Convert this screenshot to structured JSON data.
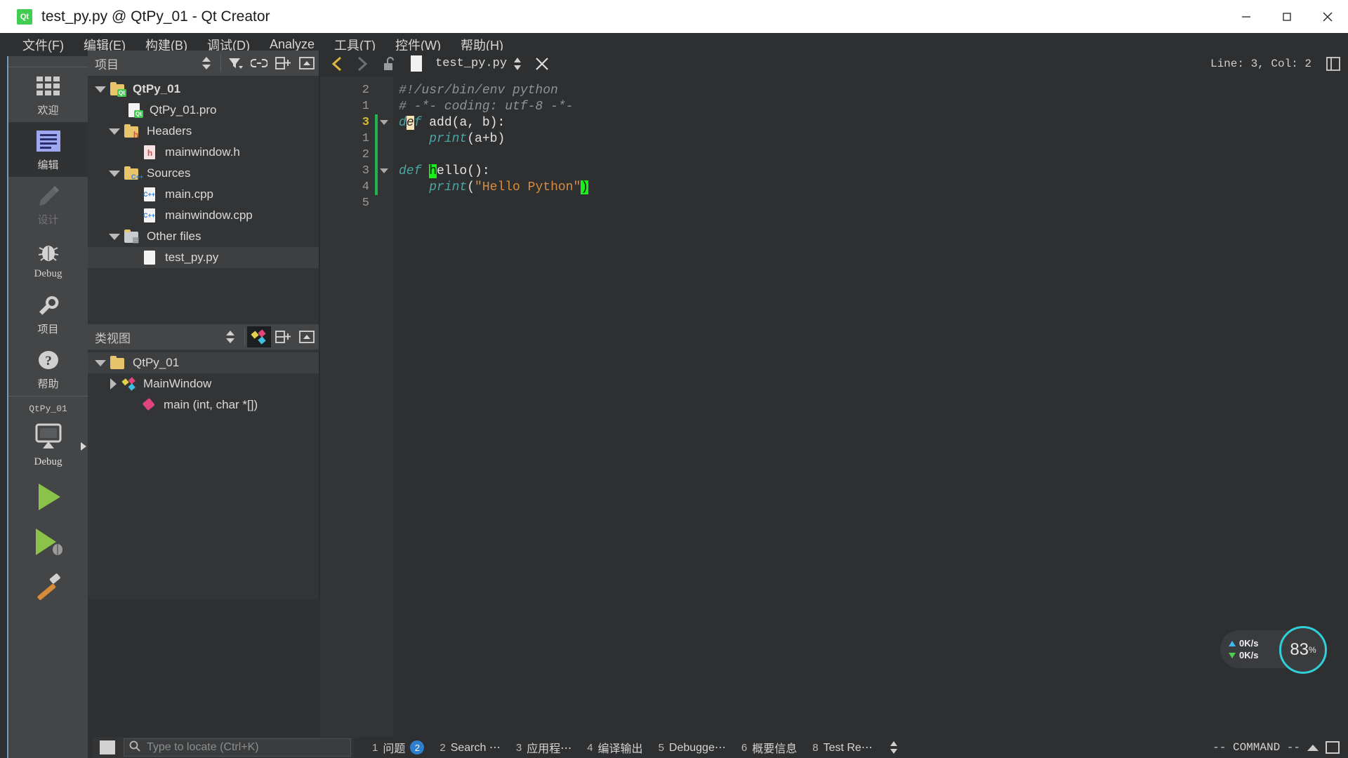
{
  "window": {
    "title": "test_py.py @ QtPy_01 - Qt Creator",
    "app_icon": "qt-logo-icon",
    "minimize": "—",
    "maximize": "□",
    "close": "✕"
  },
  "menubar": {
    "items": [
      {
        "label": "文件(F)"
      },
      {
        "label": "编辑(E)"
      },
      {
        "label": "构建(B)"
      },
      {
        "label": "调试(D)"
      },
      {
        "label": "Analyze"
      },
      {
        "label": "工具(T)"
      },
      {
        "label": "控件(W)"
      },
      {
        "label": "帮助(H)"
      }
    ]
  },
  "modebar": {
    "modes": [
      {
        "label": "欢迎",
        "icon": "grid-icon",
        "state": "normal"
      },
      {
        "label": "编辑",
        "icon": "lines-icon",
        "state": "selected"
      },
      {
        "label": "设计",
        "icon": "pencil-icon",
        "state": "disabled"
      },
      {
        "label": "Debug",
        "icon": "bug-icon",
        "state": "normal"
      },
      {
        "label": "项目",
        "icon": "wrench-icon",
        "state": "normal"
      },
      {
        "label": "帮助",
        "icon": "question-icon",
        "state": "normal"
      }
    ],
    "kit": {
      "project": "QtPy_01",
      "icon": "monitor-icon",
      "build_config": "Debug",
      "expand": "kit-expand-arrow"
    },
    "run_buttons": [
      {
        "name": "run-button",
        "icon": "green-play-icon"
      },
      {
        "name": "debug-button",
        "icon": "green-play-bug-icon"
      },
      {
        "name": "build-button",
        "icon": "hammer-icon"
      }
    ]
  },
  "projects_panel": {
    "title": "项目",
    "toolbar": [
      {
        "name": "sort-selector",
        "icon": "up-down-arrows-icon"
      },
      {
        "name": "filter-button",
        "icon": "filter-icon"
      },
      {
        "name": "sync-button",
        "icon": "link-icon"
      },
      {
        "name": "split-button",
        "icon": "split-add-icon"
      },
      {
        "name": "close-panel-button",
        "icon": "close-pane-icon"
      }
    ],
    "tree": [
      {
        "label": "QtPy_01",
        "indent": 0,
        "arrow": "down",
        "icon": "qt-folder-icon",
        "bold": true,
        "selected": false
      },
      {
        "label": "QtPy_01.pro",
        "indent": 1,
        "arrow": "none",
        "icon": "qt-file-icon",
        "bold": false,
        "selected": false
      },
      {
        "label": "Headers",
        "indent": 1,
        "arrow": "down",
        "icon": "h-folder-icon",
        "bold": false,
        "selected": false
      },
      {
        "label": "mainwindow.h",
        "indent": 2,
        "arrow": "none",
        "icon": "h-file-icon",
        "bold": false,
        "selected": false
      },
      {
        "label": "Sources",
        "indent": 1,
        "arrow": "down",
        "icon": "cpp-folder-icon",
        "bold": false,
        "selected": false
      },
      {
        "label": "main.cpp",
        "indent": 2,
        "arrow": "none",
        "icon": "cpp-file-icon",
        "bold": false,
        "selected": false
      },
      {
        "label": "mainwindow.cpp",
        "indent": 2,
        "arrow": "none",
        "icon": "cpp-file-icon",
        "bold": false,
        "selected": false
      },
      {
        "label": "Other files",
        "indent": 1,
        "arrow": "down",
        "icon": "other-folder-icon",
        "bold": false,
        "selected": false
      },
      {
        "label": "test_py.py",
        "indent": 2,
        "arrow": "none",
        "icon": "py-file-icon",
        "bold": false,
        "selected": true
      }
    ]
  },
  "class_panel": {
    "title": "类视图",
    "toolbar": [
      {
        "name": "sort-selector",
        "icon": "up-down-arrows-icon"
      },
      {
        "name": "class-view-button",
        "icon": "qt-diamond-icon"
      },
      {
        "name": "split-button",
        "icon": "split-add-icon"
      },
      {
        "name": "close-panel-button",
        "icon": "close-pane-icon"
      }
    ],
    "tree": [
      {
        "label": "QtPy_01",
        "indent": 0,
        "arrow": "down",
        "icon": "folder-icon",
        "selected": true
      },
      {
        "label": "MainWindow",
        "indent": 1,
        "arrow": "right",
        "icon": "qt-diamond-icon",
        "selected": false
      },
      {
        "label": "main (int, char *[])",
        "indent": 1,
        "arrow": "none",
        "icon": "pink-diamond-icon",
        "selected": false
      }
    ]
  },
  "editor": {
    "nav_back": "chevron-left-icon",
    "nav_forward": "chevron-right-icon",
    "lock_icon": "unlocked-icon",
    "doc_icon": "document-icon",
    "filename": "test_py.py",
    "updown_icon": "up-down-arrows-icon",
    "close_icon": "close-icon",
    "line_col": "Line: 3, Col: 2",
    "split_icon": "split-editor-icon",
    "gutter": [
      "2",
      "1",
      "3",
      "1",
      "2",
      "3",
      "4",
      "5"
    ],
    "current_gutter_index": 2,
    "fold_markers": [
      2,
      5
    ],
    "lines": [
      {
        "tokens": [
          {
            "t": "#!/usr/bin/env python",
            "c": "c-comment"
          }
        ]
      },
      {
        "tokens": [
          {
            "t": "# -*- coding: utf-8 -*-",
            "c": "c-comment"
          }
        ]
      },
      {
        "tokens": [
          {
            "t": "d",
            "c": "c-kw"
          },
          {
            "t": "e",
            "c": "hl-yellow c-kw"
          },
          {
            "t": "f",
            "c": "c-kw"
          },
          {
            "t": " ",
            "c": "c-plain"
          },
          {
            "t": "add(a, b):",
            "c": "c-fn"
          }
        ]
      },
      {
        "tokens": [
          {
            "t": "    ",
            "c": "c-plain"
          },
          {
            "t": "print",
            "c": "c-builtin"
          },
          {
            "t": "(a+b)",
            "c": "c-plain"
          }
        ]
      },
      {
        "tokens": []
      },
      {
        "tokens": [
          {
            "t": "def",
            "c": "c-kw"
          },
          {
            "t": " ",
            "c": "c-plain"
          },
          {
            "t": "h",
            "c": "hl-green"
          },
          {
            "t": "ello():",
            "c": "c-fn"
          }
        ]
      },
      {
        "tokens": [
          {
            "t": "    ",
            "c": "c-plain"
          },
          {
            "t": "print",
            "c": "c-builtin"
          },
          {
            "t": "(",
            "c": "c-plain"
          },
          {
            "t": "\"Hello Python\"",
            "c": "c-str"
          },
          {
            "t": ")",
            "c": "hl-paren"
          }
        ]
      },
      {
        "tokens": []
      }
    ]
  },
  "locator": {
    "menu_icon": "locator-menu-icon",
    "search_icon": "magnifier-icon",
    "placeholder": "Type to locate (Ctrl+K)"
  },
  "statusbar": {
    "panes": [
      {
        "num": "1",
        "label": "问题",
        "badge": "2"
      },
      {
        "num": "2",
        "label": "Search ⋯",
        "badge": ""
      },
      {
        "num": "3",
        "label": "应用程⋯",
        "badge": ""
      },
      {
        "num": "4",
        "label": "编译输出",
        "badge": ""
      },
      {
        "num": "5",
        "label": "Debugge⋯",
        "badge": ""
      },
      {
        "num": "6",
        "label": "概要信息",
        "badge": ""
      },
      {
        "num": "8",
        "label": "Test Re⋯",
        "badge": ""
      }
    ],
    "command_mode": "-- COMMAND --",
    "updown_icon": "up-down-arrows-icon",
    "caret_icon": "caret-up-icon",
    "maximize_output_icon": "maximize-pane-icon"
  },
  "overlay": {
    "net_up_value": "0K/s",
    "net_down_value": "0K/s",
    "cpu_value": "83",
    "cpu_unit": "%",
    "accent_ring": "#2fd0d8"
  }
}
